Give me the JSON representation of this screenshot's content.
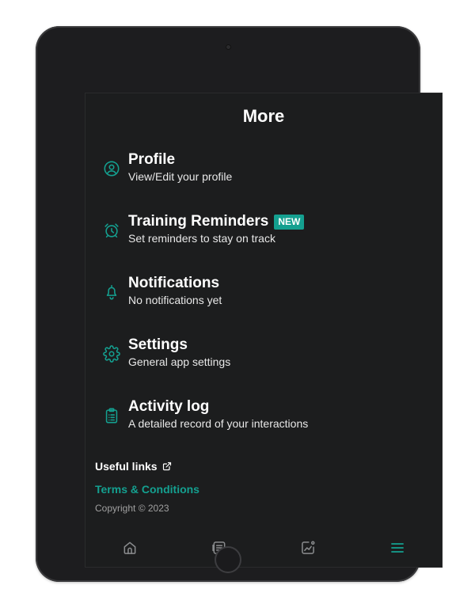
{
  "header": {
    "title": "More"
  },
  "menu": [
    {
      "label": "Profile",
      "description": "View/Edit your profile",
      "icon": "user-circle-icon"
    },
    {
      "label": "Training Reminders",
      "badge": "NEW",
      "description": "Set reminders to stay on track",
      "icon": "alarm-clock-icon"
    },
    {
      "label": "Notifications",
      "description": "No notifications yet",
      "icon": "bell-icon"
    },
    {
      "label": "Settings",
      "description": "General app settings",
      "icon": "gear-icon"
    },
    {
      "label": "Activity log",
      "description": "A detailed record of your interactions",
      "icon": "clipboard-list-icon"
    }
  ],
  "footer": {
    "useful_links": "Useful links",
    "terms": "Terms & Conditions",
    "copyright": "Copyright © 2023"
  },
  "bottom_nav": [
    {
      "icon": "home-icon",
      "active": false
    },
    {
      "icon": "journal-icon",
      "active": false
    },
    {
      "icon": "progress-chart-icon",
      "active": false
    },
    {
      "icon": "menu-icon",
      "active": true
    }
  ],
  "colors": {
    "accent": "#14a090",
    "background": "#1c1d1e",
    "device_frame": "#1d1d1f",
    "text_primary": "#ffffff",
    "text_secondary": "#a0a0a0"
  }
}
